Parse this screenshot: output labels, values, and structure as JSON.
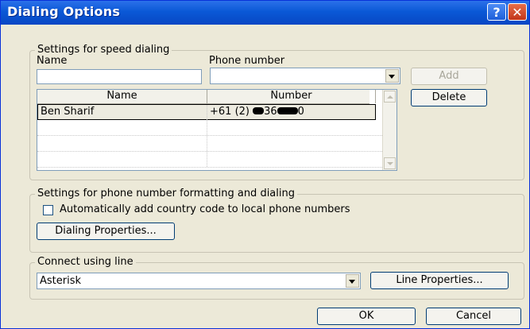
{
  "window": {
    "title": "Dialing Options",
    "help_label": "?",
    "close_label": "✕"
  },
  "speed_dial": {
    "group_label": "Settings for speed dialing",
    "name_label": "Name",
    "phone_label": "Phone number",
    "name_value": "",
    "phone_value": "",
    "add_label": "Add",
    "delete_label": "Delete",
    "columns": [
      "Name",
      "Number"
    ],
    "rows": [
      {
        "name": "Ben Sharif",
        "number_prefix": "+61 (2) ",
        "number_mid": "36",
        "number_suffix": "0"
      }
    ]
  },
  "formatting": {
    "group_label": "Settings for phone number formatting and dialing",
    "auto_country_code_label": "Automatically add country code to local phone numbers",
    "auto_country_code_checked": false,
    "dialing_properties_label": "Dialing Properties..."
  },
  "line": {
    "group_label": "Connect using line",
    "selected": "Asterisk",
    "line_properties_label": "Line Properties..."
  },
  "footer": {
    "ok_label": "OK",
    "cancel_label": "Cancel"
  }
}
